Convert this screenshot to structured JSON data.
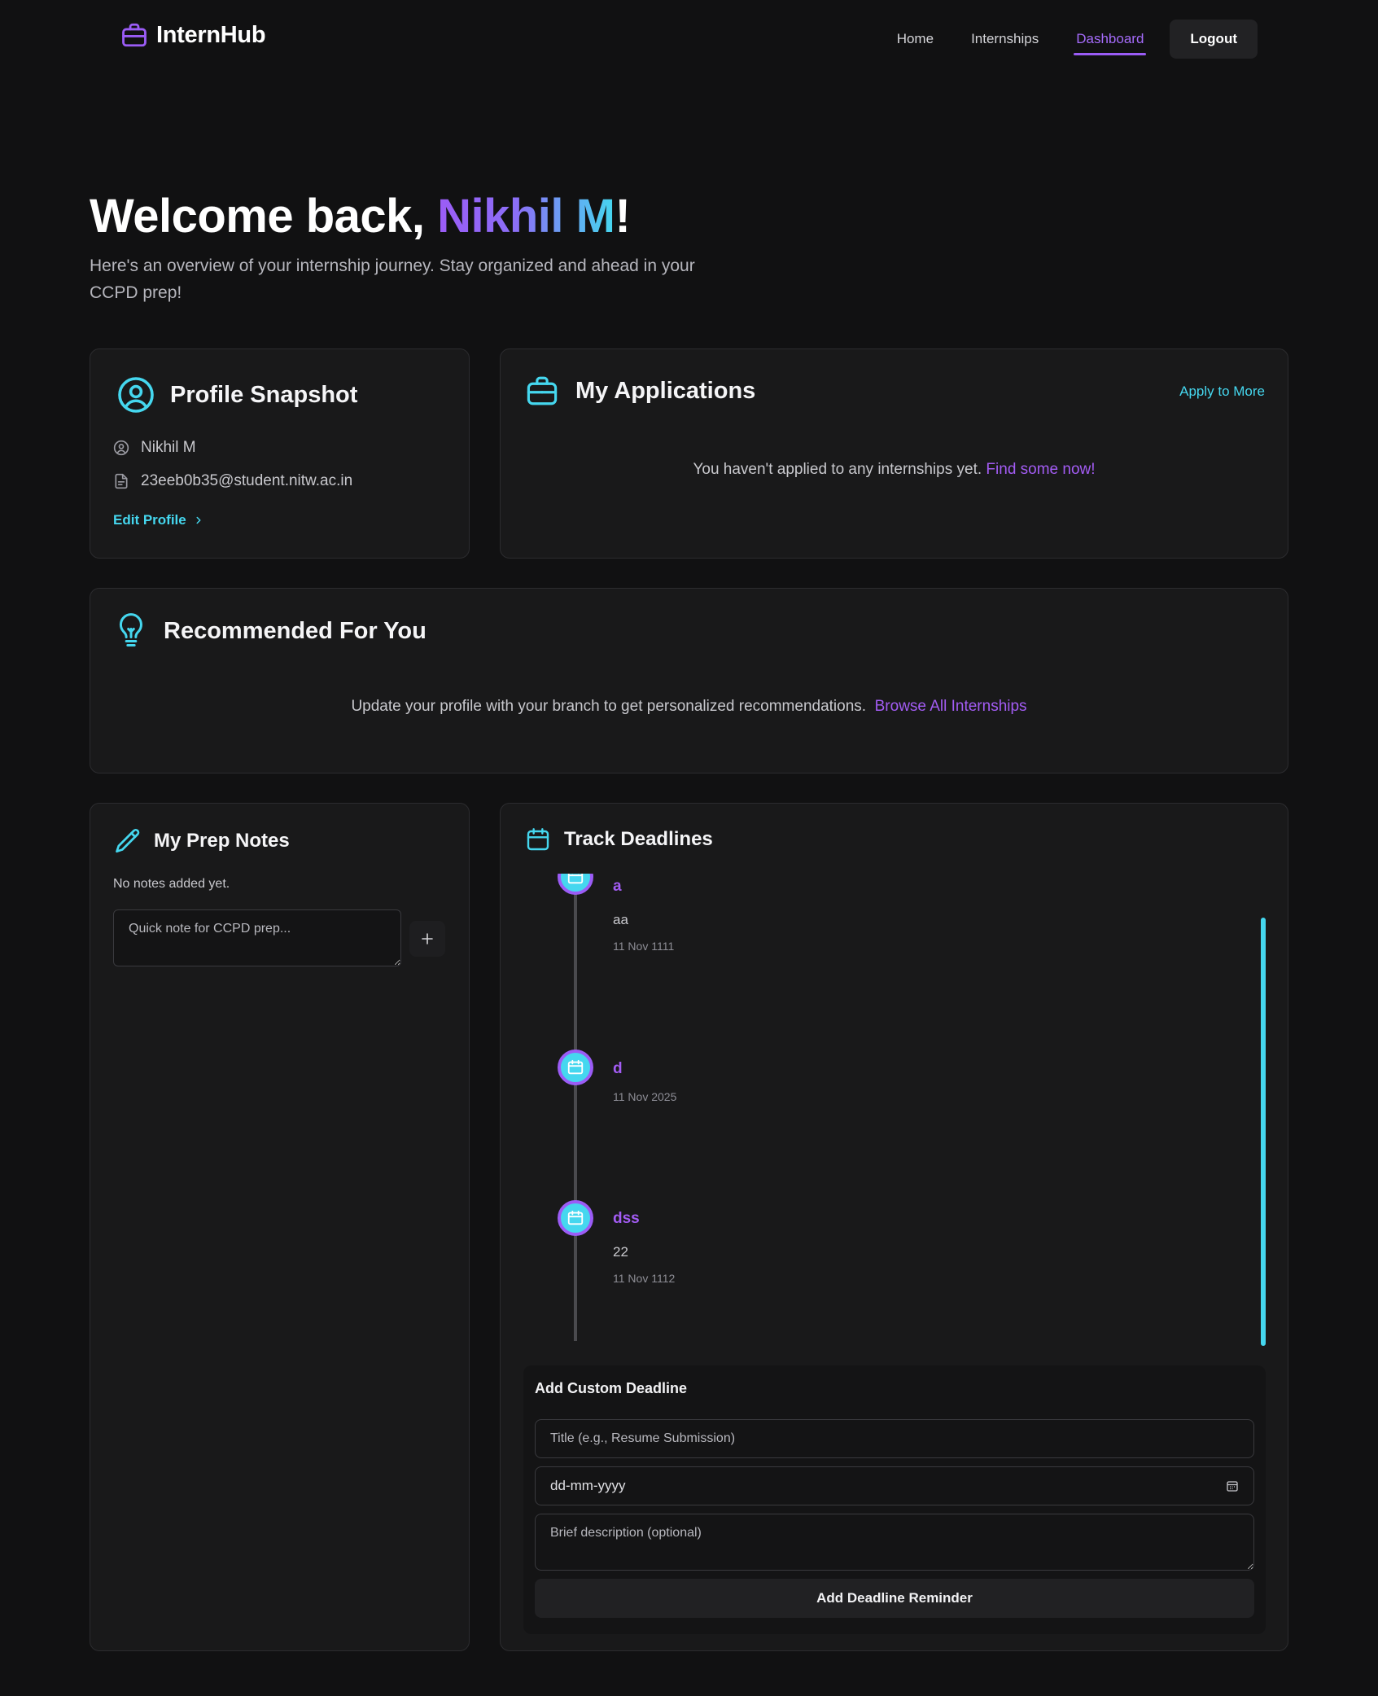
{
  "nav": {
    "brand": "InternHub",
    "links": [
      "Home",
      "Internships",
      "Dashboard"
    ],
    "active_link": "Dashboard",
    "logout": "Logout"
  },
  "hero": {
    "title_prefix": "Welcome back, ",
    "user_name": "Nikhil M",
    "title_suffix": "!",
    "subtitle": "Here's an overview of your internship journey. Stay organized and ahead in your CCPD prep!"
  },
  "profile": {
    "title": "Profile Snapshot",
    "name": "Nikhil M",
    "email": "23eeb0b35@student.nitw.ac.in",
    "edit_label": "Edit Profile"
  },
  "applications": {
    "title": "My Applications",
    "apply_more": "Apply to More",
    "empty_text": "You haven't applied to any internships yet.",
    "empty_link": "Find some now!"
  },
  "recommended": {
    "title": "Recommended For You",
    "text": "Update your profile with your branch to get personalized recommendations.",
    "link": "Browse All Internships"
  },
  "notes": {
    "title": "My Prep Notes",
    "empty_text": "No notes added yet.",
    "input_placeholder": "Quick note for CCPD prep..."
  },
  "deadlines": {
    "title": "Track Deadlines",
    "items": [
      {
        "title": "a",
        "description": "aa",
        "date": "11 Nov 1111"
      },
      {
        "title": "d",
        "description": "",
        "date": "11 Nov 2025"
      },
      {
        "title": "dss",
        "description": "22",
        "date": "11 Nov 1112"
      }
    ],
    "form": {
      "title": "Add Custom Deadline",
      "title_placeholder": "Title (e.g., Resume Submission)",
      "date_placeholder": "dd-mm-yyyy",
      "desc_placeholder": "Brief description (optional)",
      "submit": "Add Deadline Reminder"
    }
  },
  "colors": {
    "accent_purple": "#9b5cf6",
    "accent_cyan": "#45d7ef",
    "background": "#111112",
    "card": "#19191a"
  }
}
